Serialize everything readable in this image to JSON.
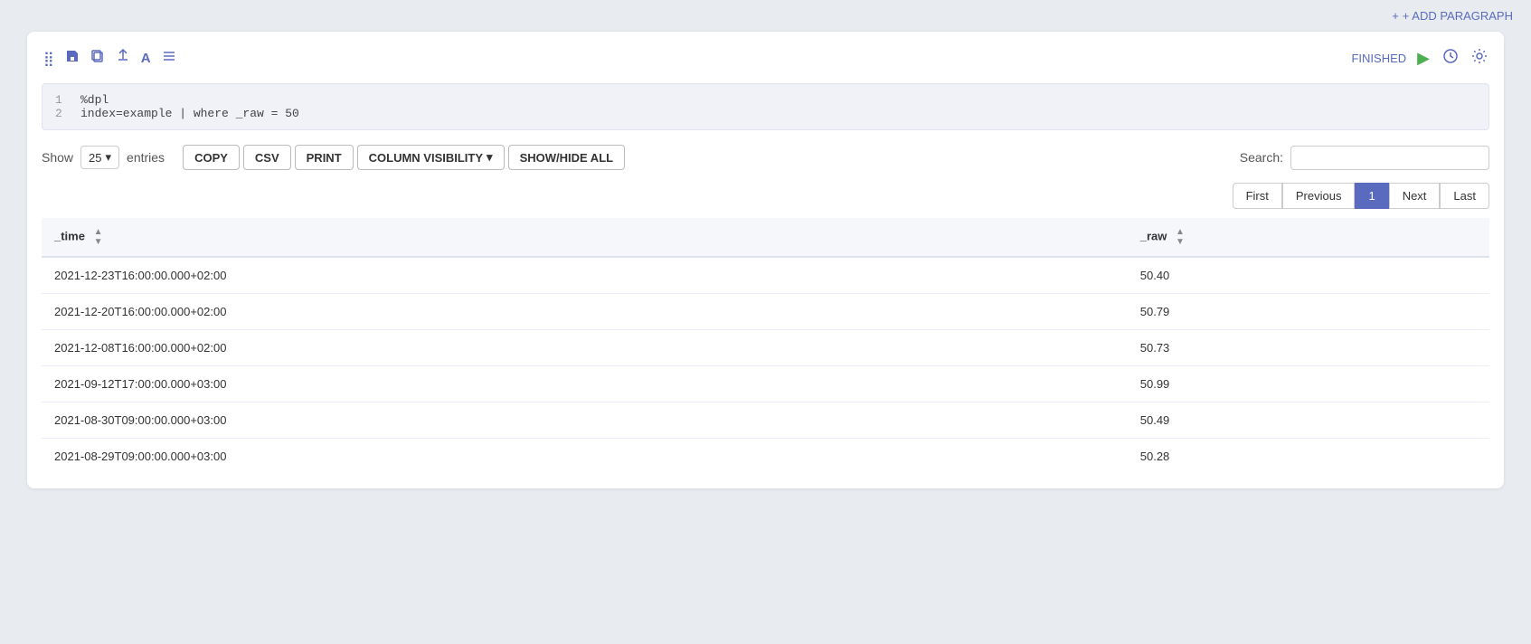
{
  "topbar": {
    "add_paragraph": "+ ADD PARAGRAPH"
  },
  "toolbar": {
    "icons": [
      "move-icon",
      "save-icon",
      "copy-icon",
      "upload-icon",
      "text-icon",
      "list-icon"
    ],
    "finished_label": "FINISHED",
    "run_icon": "▶",
    "clock_icon": "🕐",
    "settings_icon": "⚙"
  },
  "code": {
    "lines": [
      {
        "num": "1",
        "content": "%dpl"
      },
      {
        "num": "2",
        "content": "index=example | where _raw = 50"
      }
    ]
  },
  "controls": {
    "show_label": "Show",
    "entries_value": "25",
    "entries_label": "entries",
    "buttons": [
      "COPY",
      "CSV",
      "PRINT"
    ],
    "column_visibility": "COLUMN VISIBILITY",
    "show_hide_all": "SHOW/HIDE ALL",
    "search_label": "Search:"
  },
  "pagination": {
    "buttons": [
      {
        "label": "First",
        "active": false
      },
      {
        "label": "Previous",
        "active": false
      },
      {
        "label": "1",
        "active": true
      },
      {
        "label": "Next",
        "active": false
      },
      {
        "label": "Last",
        "active": false
      }
    ]
  },
  "table": {
    "columns": [
      {
        "key": "_time",
        "label": "_time",
        "sortable": true
      },
      {
        "key": "_raw",
        "label": "_raw",
        "sortable": true
      }
    ],
    "rows": [
      {
        "_time": "2021-12-23T16:00:00.000+02:00",
        "_raw": "50.40"
      },
      {
        "_time": "2021-12-20T16:00:00.000+02:00",
        "_raw": "50.79"
      },
      {
        "_time": "2021-12-08T16:00:00.000+02:00",
        "_raw": "50.73"
      },
      {
        "_time": "2021-09-12T17:00:00.000+03:00",
        "_raw": "50.99"
      },
      {
        "_time": "2021-08-30T09:00:00.000+03:00",
        "_raw": "50.49"
      },
      {
        "_time": "2021-08-29T09:00:00.000+03:00",
        "_raw": "50.28"
      }
    ]
  }
}
